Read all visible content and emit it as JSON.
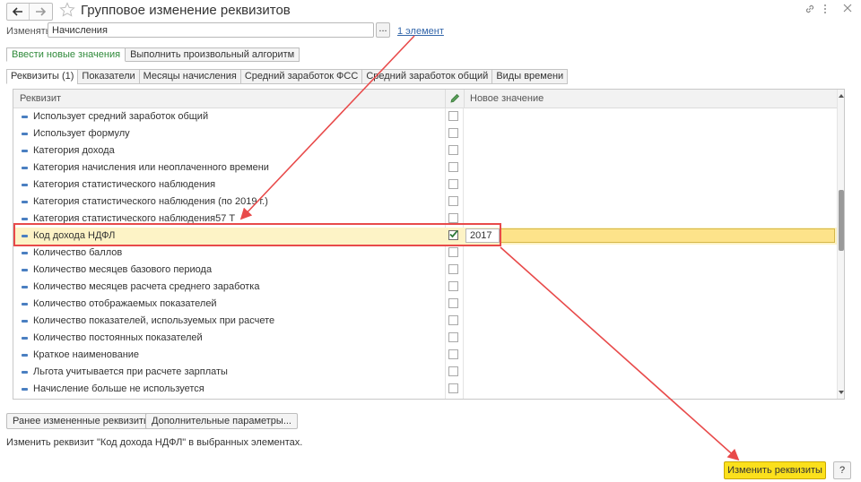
{
  "window": {
    "title": "Групповое изменение реквизитов"
  },
  "edit_row": {
    "label": "Изменять:",
    "value": "Начисления",
    "select_button": "...",
    "count_link": "1 элемент"
  },
  "mode_buttons": {
    "enter_new": "Ввести новые значения",
    "run_algorithm": "Выполнить произвольный алгоритм"
  },
  "tabs": [
    "Реквизиты (1)",
    "Показатели",
    "Месяцы начисления",
    "Средний заработок ФСС",
    "Средний заработок общий",
    "Виды времени"
  ],
  "table": {
    "col_name": "Реквизит",
    "col_value": "Новое значение",
    "rows": [
      {
        "name": "Использует средний заработок общий",
        "checked": false
      },
      {
        "name": "Использует формулу",
        "checked": false
      },
      {
        "name": "Категория дохода",
        "checked": false
      },
      {
        "name": "Категория начисления или неоплаченного времени",
        "checked": false
      },
      {
        "name": "Категория статистического наблюдения",
        "checked": false
      },
      {
        "name": "Категория статистического наблюдения (по 2019 г.)",
        "checked": false
      },
      {
        "name": "Категория статистического наблюдения57 Т",
        "checked": false
      },
      {
        "name": "Код дохода НДФЛ",
        "checked": true,
        "value": "2017"
      },
      {
        "name": "Количество баллов",
        "checked": false
      },
      {
        "name": "Количество месяцев базового периода",
        "checked": false
      },
      {
        "name": "Количество месяцев расчета среднего заработка",
        "checked": false
      },
      {
        "name": "Количество отображаемых показателей",
        "checked": false
      },
      {
        "name": "Количество показателей, используемых при расчете",
        "checked": false
      },
      {
        "name": "Количество постоянных показателей",
        "checked": false
      },
      {
        "name": "Краткое наименование",
        "checked": false
      },
      {
        "name": "Льгота учитывается при расчете зарплаты",
        "checked": false
      },
      {
        "name": "Начисление больше не используется",
        "checked": false
      }
    ]
  },
  "bottom": {
    "recent_button": "Ранее измененные реквизиты",
    "extra_button": "Дополнительные параметры...",
    "status": "Изменить реквизит \"Код дохода НДФЛ\" в выбранных элементах.",
    "primary_button": "Изменить реквизиты",
    "help_button": "?"
  },
  "colors": {
    "accent_yellow": "#fbe01c",
    "annotation_red": "#e84a4a",
    "selected_row": "#fdf3c6"
  }
}
